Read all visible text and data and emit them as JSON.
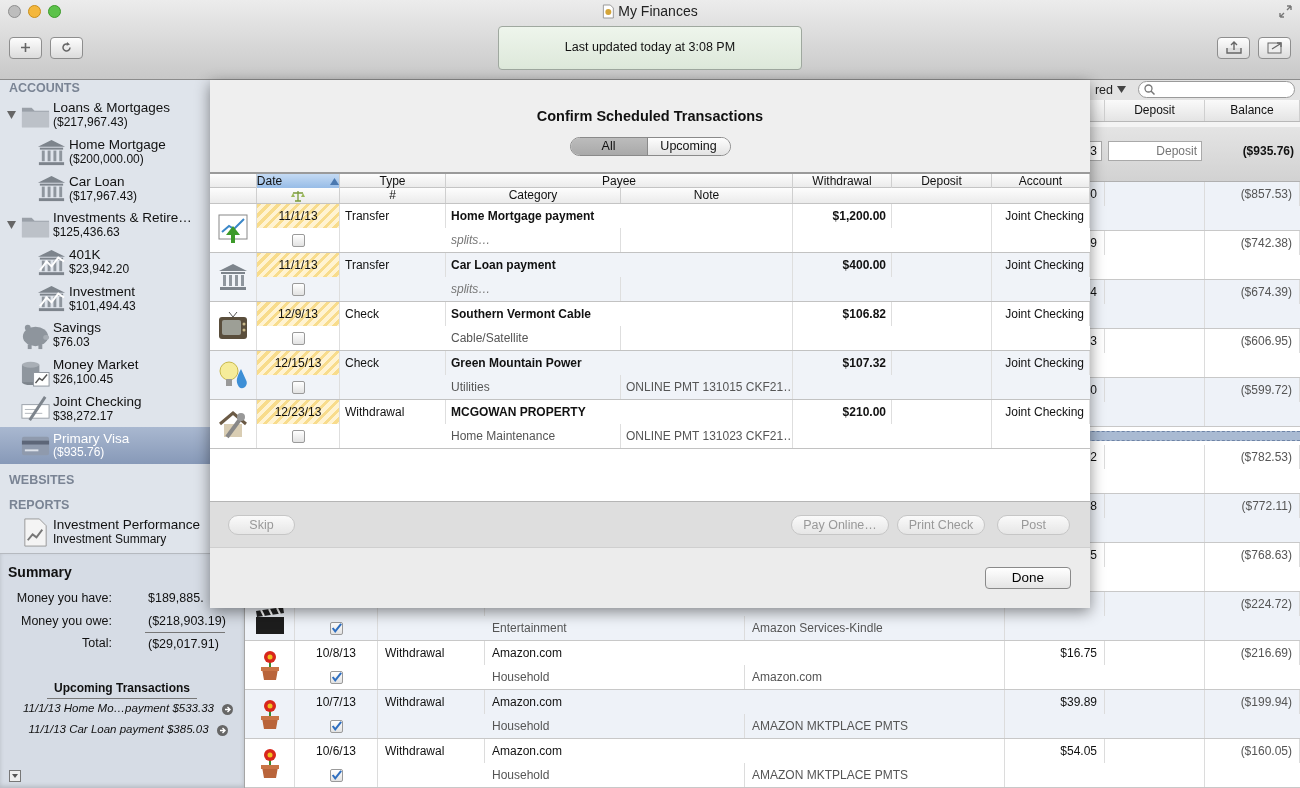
{
  "window": {
    "title": "My Finances"
  },
  "toolbar": {
    "status": "Last updated today at 3:08 PM"
  },
  "sidebar": {
    "sections": [
      {
        "title": "ACCOUNTS",
        "items": [
          {
            "kind": "folder",
            "name": "Loans & Mortgages",
            "balance": "($217,967.43)",
            "expanded": true,
            "selected": false,
            "children": [
              {
                "kind": "loan",
                "name": "Home Mortgage",
                "balance": "($200,000.00)",
                "selected": false
              },
              {
                "kind": "loan",
                "name": "Car Loan",
                "balance": "($17,967.43)",
                "selected": false
              }
            ]
          },
          {
            "kind": "folder",
            "name": "Investments & Retire…",
            "balance": "$125,436.63",
            "expanded": true,
            "selected": false,
            "children": [
              {
                "kind": "brokerage",
                "name": "401K",
                "balance": "$23,942.20",
                "selected": false
              },
              {
                "kind": "brokerage",
                "name": "Investment",
                "balance": "$101,494.43",
                "selected": false
              }
            ]
          },
          {
            "kind": "savings",
            "name": "Savings",
            "balance": "$76.03",
            "selected": false
          },
          {
            "kind": "money_market",
            "name": "Money Market",
            "balance": "$26,100.45",
            "selected": false
          },
          {
            "kind": "checking",
            "name": "Joint Checking",
            "balance": "$38,272.17",
            "selected": false
          },
          {
            "kind": "credit_card",
            "name": "Primary Visa",
            "balance": "($935.76)",
            "selected": true
          }
        ]
      },
      {
        "title": "WEBSITES"
      },
      {
        "title": "REPORTS",
        "items": [
          {
            "kind": "report",
            "name": "Investment Performance",
            "balance": "Investment Summary",
            "selected": false
          }
        ]
      }
    ]
  },
  "summary": {
    "title": "Summary",
    "rows": [
      {
        "label": "Money you have:",
        "value": "$189,885."
      },
      {
        "label": "Money you owe:",
        "value": "($218,903.19)"
      },
      {
        "label": "Total:",
        "value": "($29,017.91)"
      }
    ],
    "upcoming_title": "Upcoming Transactions",
    "upcoming": [
      "11/1/13 Home Mo…payment $533.33",
      "11/1/13 Car Loan payment $385.03"
    ]
  },
  "register": {
    "filter": "red",
    "header": [
      "Deposit",
      "Balance"
    ],
    "edit_row": {
      "withdrawal": "3",
      "deposit_placeholder": "Deposit",
      "balance": "($935.76)"
    },
    "rows": [
      {
        "kind": "hidden",
        "withdrawal": "0",
        "balance": "($857.53)"
      },
      {
        "kind": "hidden",
        "withdrawal": "9",
        "balance": "($742.38)"
      },
      {
        "kind": "hidden",
        "withdrawal": "4",
        "balance": "($674.39)"
      },
      {
        "kind": "hidden",
        "withdrawal": "3",
        "balance": "($606.95)"
      },
      {
        "kind": "hidden",
        "withdrawal": "0",
        "balance": "($599.72)"
      },
      {
        "kind": "divider"
      },
      {
        "kind": "hidden",
        "withdrawal": "2",
        "balance": "($782.53)"
      },
      {
        "kind": "hidden",
        "withdrawal": "8",
        "balance": "($772.11)"
      },
      {
        "kind": "hidden",
        "withdrawal": "5",
        "balance": "($768.63)"
      },
      {
        "kind": "lower",
        "cleared": true,
        "category": "Entertainment",
        "note": "Amazon Services-Kindle",
        "balance": "($224.72)"
      },
      {
        "kind": "full",
        "date": "10/8/13",
        "cleared": true,
        "type": "Withdrawal",
        "payee": "Amazon.com",
        "category": "Household",
        "note": "Amazon.com",
        "withdrawal": "$16.75",
        "balance": "($216.69)"
      },
      {
        "kind": "full",
        "date": "10/7/13",
        "cleared": true,
        "type": "Withdrawal",
        "payee": "Amazon.com",
        "category": "Household",
        "note": "AMAZON MKTPLACE PMTS",
        "withdrawal": "$39.89",
        "balance": "($199.94)"
      },
      {
        "kind": "full",
        "date": "10/6/13",
        "cleared": true,
        "type": "Withdrawal",
        "payee": "Amazon.com",
        "category": "Household",
        "note": "AMAZON MKTPLACE PMTS",
        "withdrawal": "$54.05",
        "balance": "($160.05)"
      }
    ]
  },
  "modal": {
    "title": "Confirm Scheduled Transactions",
    "segments": [
      {
        "label": "All",
        "selected": true
      },
      {
        "label": "Upcoming",
        "selected": false
      }
    ],
    "columns": [
      {
        "label": "Date",
        "selected": true
      },
      {
        "label": "Type",
        "selected": false
      },
      {
        "label": "Payee",
        "selected": false
      },
      {
        "label": "Withdrawal",
        "selected": false
      },
      {
        "label": "Deposit",
        "selected": false
      },
      {
        "label": "Account",
        "selected": false
      }
    ],
    "subcolumns": [
      "#",
      "Category",
      "Note"
    ],
    "rows": [
      {
        "kind": "transfer",
        "date": "11/1/13",
        "cleared": false,
        "type": "Transfer",
        "payee": "Home Mortgage payment",
        "category": "splits…",
        "split": true,
        "withdrawal": "$1,200.00",
        "account": "Joint Checking"
      },
      {
        "kind": "loan",
        "date": "11/1/13",
        "cleared": false,
        "type": "Transfer",
        "payee": "Car Loan payment",
        "category": "splits…",
        "split": true,
        "withdrawal": "$400.00",
        "account": "Joint Checking"
      },
      {
        "kind": "cable",
        "date": "12/9/13",
        "cleared": false,
        "type": "Check",
        "payee": "Southern Vermont Cable",
        "category": "Cable/Satellite",
        "split": false,
        "withdrawal": "$106.82",
        "account": "Joint Checking"
      },
      {
        "kind": "utility",
        "date": "12/15/13",
        "cleared": false,
        "type": "Check",
        "payee": "Green Mountain Power",
        "category": "Utilities",
        "split": false,
        "note": "ONLINE PMT 131015 CKF21…",
        "withdrawal": "$107.32",
        "account": "Joint Checking"
      },
      {
        "kind": "property",
        "date": "12/23/13",
        "cleared": false,
        "type": "Withdrawal",
        "payee": "MCGOWAN PROPERTY",
        "category": "Home Maintenance",
        "split": false,
        "note": "ONLINE PMT 131023 CKF21…",
        "withdrawal": "$210.00",
        "account": "Joint Checking"
      }
    ],
    "buttons": [
      {
        "label": "Skip",
        "disabled": true
      },
      {
        "label": "Pay Online…",
        "disabled": true
      },
      {
        "label": "Print Check",
        "disabled": true
      },
      {
        "label": "Post",
        "disabled": true
      }
    ],
    "done": "Done"
  }
}
